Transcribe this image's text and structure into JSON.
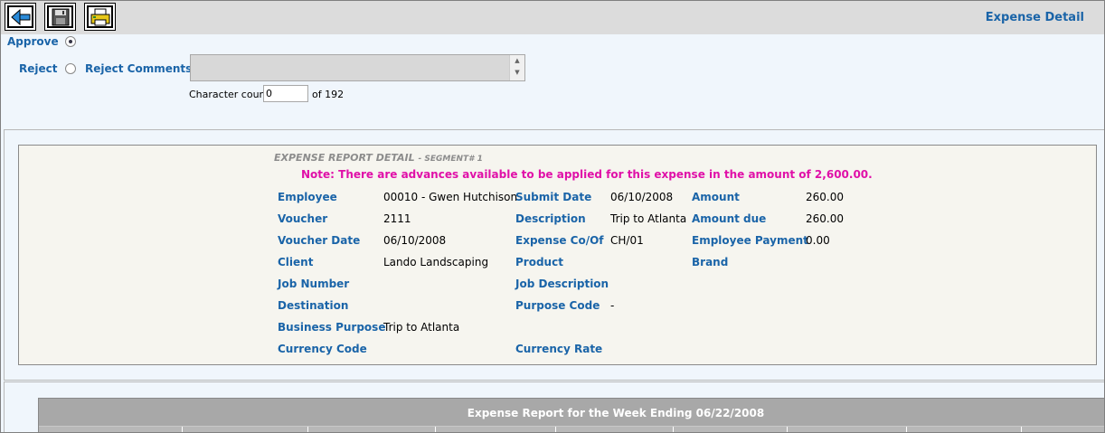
{
  "header": {
    "title": "Expense Detail",
    "buttons": [
      {
        "name": "back-button",
        "icon": "back-arrow-icon"
      },
      {
        "name": "save-button",
        "icon": "floppy-disk-icon"
      },
      {
        "name": "print-button",
        "icon": "printer-icon"
      }
    ]
  },
  "approval": {
    "approve_label": "Approve",
    "reject_label": "Reject",
    "reject_comments_label": "Reject Comments",
    "selected": "approve",
    "comments_value": "",
    "char_count_label": "Character count",
    "char_count_value": "0",
    "char_count_max": "of 192"
  },
  "detail": {
    "title": "EXPENSE REPORT DETAIL",
    "segment": "- SEGMENT# 1",
    "note": "Note: There are advances available to be applied for this expense in the amount of 2,600.00.",
    "col1": [
      {
        "label": "Employee",
        "value": "00010 - Gwen Hutchison"
      },
      {
        "label": "Voucher",
        "value": "2111"
      },
      {
        "label": "Voucher Date",
        "value": "06/10/2008"
      },
      {
        "label": "Client",
        "value": "Lando Landscaping"
      },
      {
        "label": "Job Number",
        "value": ""
      },
      {
        "label": "Destination",
        "value": ""
      },
      {
        "label": "Business Purpose",
        "value": "Trip to Atlanta"
      },
      {
        "label": "Currency Code",
        "value": ""
      }
    ],
    "col2": [
      {
        "label": "Submit Date",
        "value": "06/10/2008"
      },
      {
        "label": "Description",
        "value": "Trip to Atlanta"
      },
      {
        "label": "Expense Co/Of",
        "value": "CH/01"
      },
      {
        "label": "Product",
        "value": ""
      },
      {
        "label": "Job Description",
        "value": ""
      },
      {
        "label": "Purpose Code",
        "value": "-"
      },
      {
        "label": "",
        "value": ""
      },
      {
        "label": "Currency Rate",
        "value": ""
      }
    ],
    "col3": [
      {
        "label": "Amount",
        "value": "260.00"
      },
      {
        "label": "Amount due",
        "value": "260.00"
      },
      {
        "label": "Employee Payment",
        "value": "0.00"
      },
      {
        "label": "Brand",
        "value": ""
      }
    ]
  },
  "weekly": {
    "title": "Expense Report for the Week Ending 06/22/2008"
  }
}
